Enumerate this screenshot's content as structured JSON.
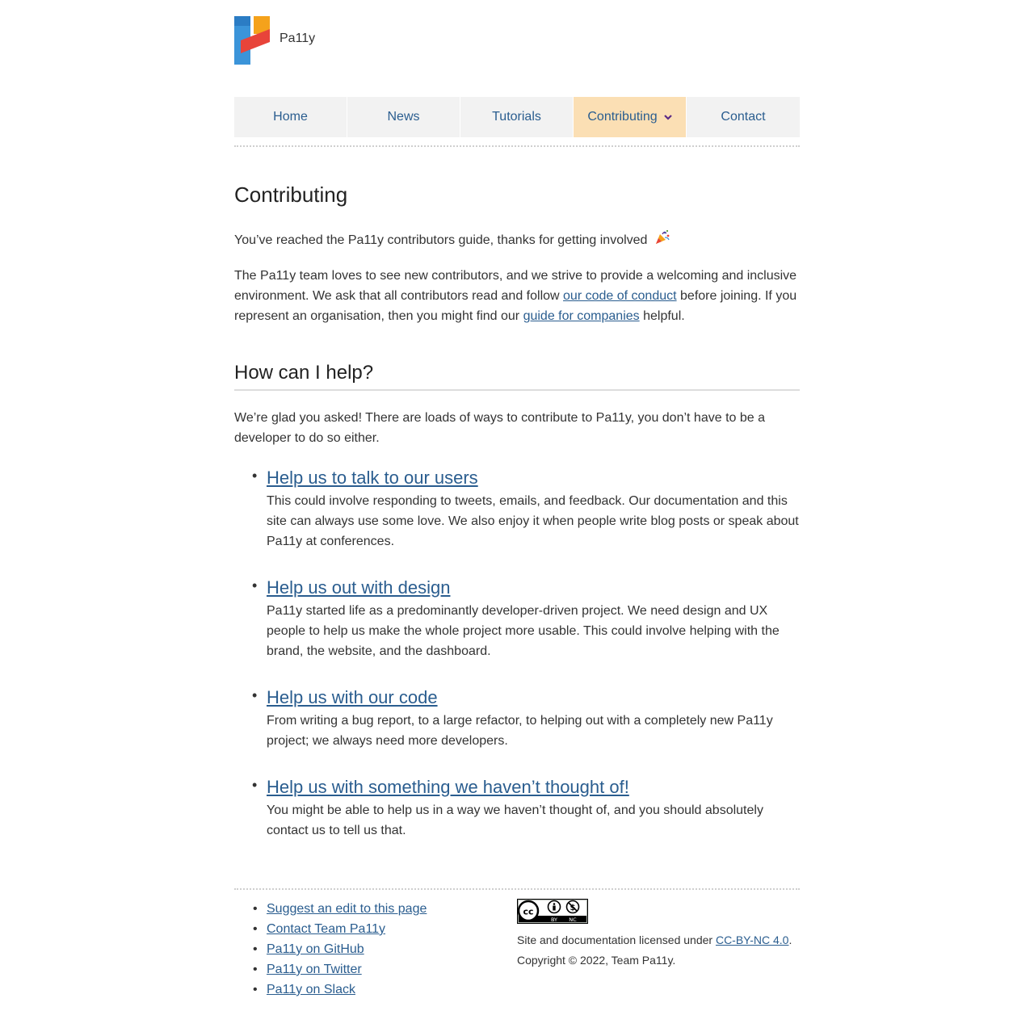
{
  "brand": {
    "name": "Pa11y"
  },
  "nav": {
    "items": [
      {
        "label": "Home"
      },
      {
        "label": "News"
      },
      {
        "label": "Tutorials"
      },
      {
        "label": "Contributing"
      },
      {
        "label": "Contact"
      }
    ],
    "active": "Contributing"
  },
  "page": {
    "title": "Contributing",
    "intro": "You’ve reached the Pa11y contributors guide, thanks for getting involved",
    "para2": {
      "before": "The Pa11y team loves to see new contributors, and we strive to provide a welcoming and inclusive environment. We ask that all contributors read and follow ",
      "link1": "our code of conduct",
      "middle": " before joining. If you represent an organisation, then you might find our ",
      "link2": "guide for companies",
      "after": " helpful."
    },
    "section_title": "How can I help?",
    "section_intro": "We’re glad you asked! There are loads of ways to contribute to Pa11y, you don’t have to be a developer to do so either.",
    "help_items": [
      {
        "title": "Help us to talk to our users",
        "desc": "This could involve responding to tweets, emails, and feedback. Our documentation and this site can always use some love. We also enjoy it when people write blog posts or speak about Pa11y at conferences."
      },
      {
        "title": "Help us out with design",
        "desc": "Pa11y started life as a predominantly developer-driven project. We need design and UX people to help us make the whole project more usable. This could involve helping with the brand, the website, and the dashboard."
      },
      {
        "title": "Help us with our code",
        "desc": "From writing a bug report, to a large refactor, to helping out with a completely new Pa11y project; we always need more developers."
      },
      {
        "title": "Help us with something we haven’t thought of!",
        "desc": "You might be able to help us in a way we haven’t thought of, and you should absolutely contact us to tell us that."
      }
    ]
  },
  "footer": {
    "links": [
      {
        "label": "Suggest an edit to this page"
      },
      {
        "label": "Contact Team Pa11y"
      },
      {
        "label": "Pa11y on GitHub"
      },
      {
        "label": "Pa11y on Twitter"
      },
      {
        "label": "Pa11y on Slack"
      }
    ],
    "cc_badge": {
      "by": "BY",
      "nc": "NC"
    },
    "license_text": "Site and documentation licensed under ",
    "license_link": "CC-BY-NC 4.0",
    "license_end": ".",
    "copyright": "Copyright © 2022, Team Pa11y."
  },
  "colors": {
    "link": "#2a5d8f",
    "nav_bg": "#f2f2f2",
    "nav_active_bg": "#fbdfb4",
    "chevron": "#5b2a86"
  }
}
